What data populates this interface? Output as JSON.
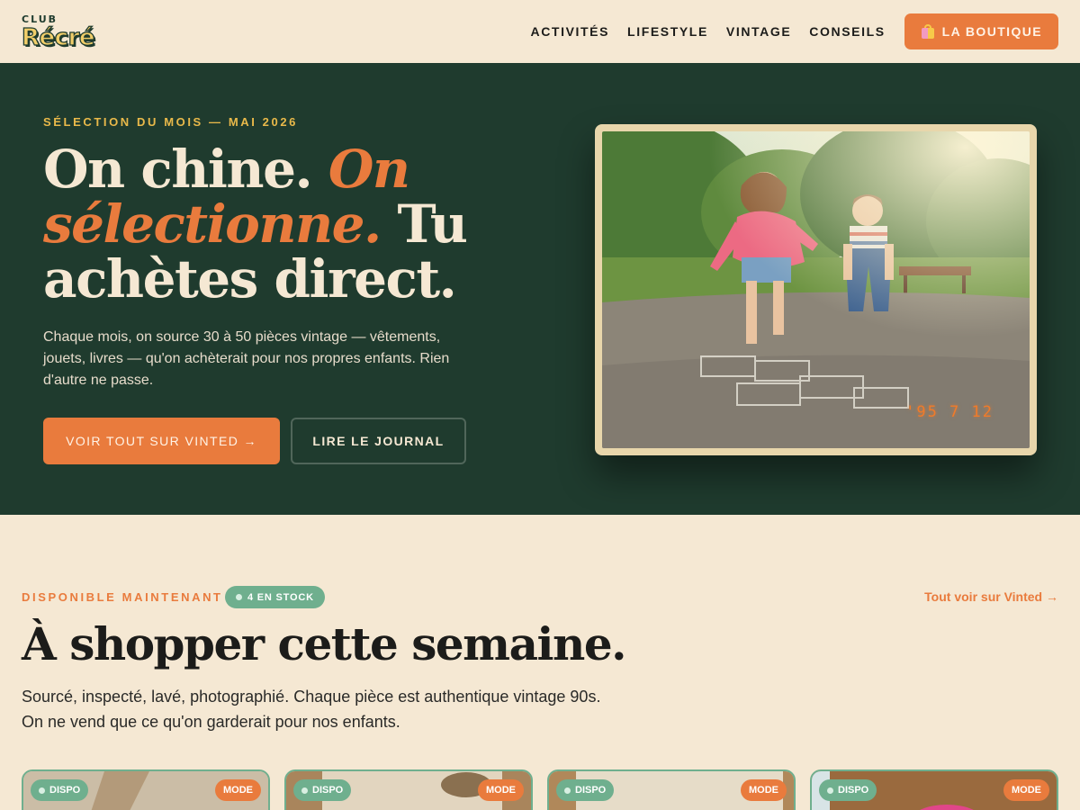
{
  "header": {
    "logo_top": "CLUB",
    "logo_main": "Récré",
    "nav": [
      "ACTIVITÉS",
      "LIFESTYLE",
      "VINTAGE",
      "CONSEILS"
    ],
    "shop_button": "LA BOUTIQUE"
  },
  "hero": {
    "eyebrow": "SÉLECTION DU MOIS — MAI 2026",
    "title_part1": "On chine. ",
    "title_accent": "On sélectionne.",
    "title_part2": " Tu achètes direct.",
    "text": "Chaque mois, on source 30 à 50 pièces vintage — vêtements, jouets, livres — qu'on achèterait pour nos propres enfants. Rien d'autre ne passe.",
    "primary_button": "VOIR TOUT SUR VINTED →",
    "secondary_button": "LIRE LE JOURNAL",
    "photo_stamp": "'95 7 12"
  },
  "shop": {
    "eyebrow": "DISPONIBLE MAINTENANT",
    "stock_pill": "4 EN STOCK",
    "see_all": "Tout voir sur Vinted →",
    "title": "À shopper cette semaine.",
    "text": "Sourcé, inspecté, lavé, photographié. Chaque pièce est authentique vintage 90s. On ne vend que ce qu'on garderait pour nos enfants.",
    "cards": [
      {
        "status": "DISPO",
        "category": "MODE"
      },
      {
        "status": "DISPO",
        "category": "MODE"
      },
      {
        "status": "DISPO",
        "category": "MODE"
      },
      {
        "status": "DISPO",
        "category": "MODE"
      }
    ]
  },
  "colors": {
    "cream": "#f5e8d3",
    "forest": "#1f3b2e",
    "orange": "#e97b3d",
    "mustard": "#e9b94a",
    "sage": "#6faf8e"
  }
}
